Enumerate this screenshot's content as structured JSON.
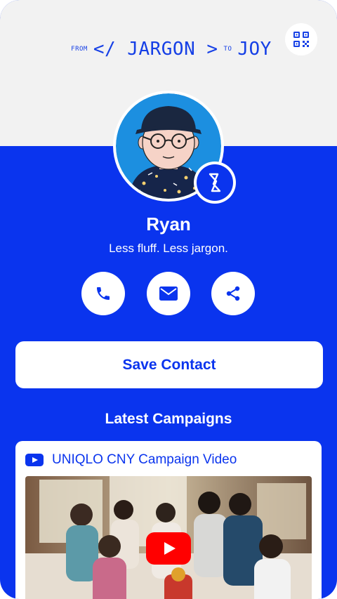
{
  "header": {
    "tagline": {
      "from": "FROM",
      "jargon": "</ JARGON >",
      "to": "TO",
      "joy": "JOY"
    },
    "qr_icon": "qr-code-icon"
  },
  "profile": {
    "name": "Ryan",
    "bio": "Less fluff. Less jargon.",
    "avatar_icon": "avatar-illustration",
    "badge_icon": "slash-logo-icon"
  },
  "actions": [
    {
      "name": "call",
      "icon": "phone-icon"
    },
    {
      "name": "email",
      "icon": "mail-icon"
    },
    {
      "name": "share",
      "icon": "share-icon"
    }
  ],
  "save_contact_label": "Save Contact",
  "campaigns": {
    "heading": "Latest Campaigns",
    "items": [
      {
        "title": "UNIQLO CNY Campaign Video",
        "icon": "youtube-icon",
        "play_icon": "play-icon"
      }
    ]
  },
  "colors": {
    "brand_blue": "#0a34ee",
    "header_gray": "#f2f2f2",
    "youtube_red": "#ff0000"
  }
}
